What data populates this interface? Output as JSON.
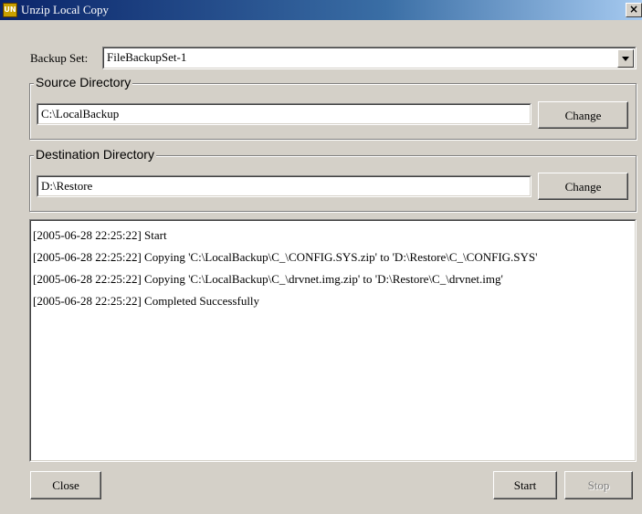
{
  "window": {
    "title": "Unzip Local Copy",
    "close_symbol": "×"
  },
  "backup_set": {
    "label": "Backup Set:",
    "value": "FileBackupSet-1"
  },
  "source": {
    "legend": "Source Directory",
    "value": "C:\\LocalBackup",
    "change_label": "Change"
  },
  "destination": {
    "legend": "Destination Directory",
    "value": "D:\\Restore",
    "change_label": "Change"
  },
  "log": [
    "[2005-06-28 22:25:22] Start",
    "[2005-06-28 22:25:22] Copying 'C:\\LocalBackup\\C_\\CONFIG.SYS.zip' to 'D:\\Restore\\C_\\CONFIG.SYS'",
    "[2005-06-28 22:25:22] Copying 'C:\\LocalBackup\\C_\\drvnet.img.zip' to 'D:\\Restore\\C_\\drvnet.img'",
    "[2005-06-28 22:25:22] Completed Successfully"
  ],
  "buttons": {
    "close": "Close",
    "start": "Start",
    "stop": "Stop"
  },
  "icons": {
    "app": "app-icon",
    "dropdown": "chevron-down-icon",
    "close": "close-icon"
  }
}
